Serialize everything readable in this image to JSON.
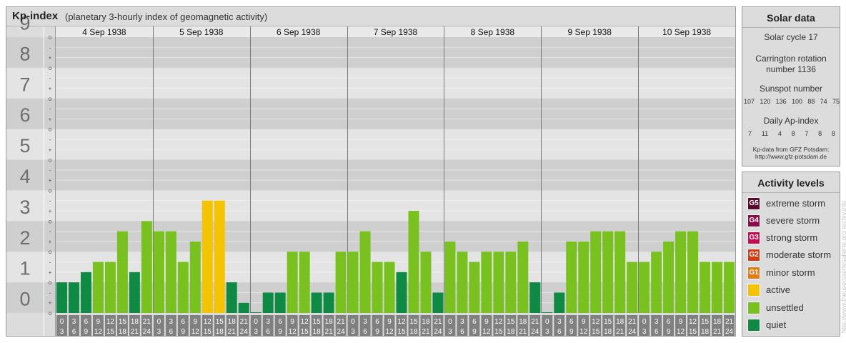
{
  "header": {
    "title": "Kp-index",
    "subtitle": "(planetary 3-hourly index of geomagnetic activity)"
  },
  "chart_data": {
    "type": "bar",
    "ylim": [
      0,
      9
    ],
    "y_tick_labels": [
      "0",
      "1",
      "2",
      "3",
      "4",
      "5",
      "6",
      "7",
      "8",
      "9"
    ],
    "sub_tick_labels": [
      "o",
      "+",
      "-",
      "o",
      "+",
      "-",
      "o",
      "+",
      "-",
      "o",
      "+",
      "-",
      "o",
      "+",
      "-",
      "o",
      "+",
      "-",
      "o",
      "+",
      "-",
      "o",
      "+",
      "-",
      "o",
      "+",
      "-",
      "o"
    ],
    "days": [
      "4 Sep 1938",
      "5 Sep 1938",
      "6 Sep 1938",
      "7 Sep 1938",
      "8 Sep 1938",
      "9 Sep 1938",
      "10 Sep 1938"
    ],
    "interval_start_hours": [
      "0",
      "3",
      "6",
      "9",
      "12",
      "15",
      "18",
      "21"
    ],
    "interval_end_hours": [
      "3",
      "6",
      "9",
      "12",
      "15",
      "18",
      "21",
      "24"
    ],
    "values": [
      [
        1.0,
        1.0,
        1.333,
        1.667,
        1.667,
        2.667,
        1.333,
        3.0
      ],
      [
        2.667,
        2.667,
        1.667,
        2.333,
        3.667,
        3.667,
        1.0,
        0.333
      ],
      [
        0.0,
        0.667,
        0.667,
        2.0,
        2.0,
        0.667,
        0.667,
        2.0
      ],
      [
        2.0,
        2.667,
        1.667,
        1.667,
        1.333,
        3.333,
        2.0,
        0.667
      ],
      [
        2.333,
        2.0,
        1.667,
        2.0,
        2.0,
        2.0,
        2.333,
        1.0
      ],
      [
        0.0,
        0.667,
        2.333,
        2.333,
        2.667,
        2.667,
        2.667,
        1.667
      ],
      [
        1.667,
        2.0,
        2.333,
        2.667,
        2.667,
        1.667,
        1.667,
        1.667
      ]
    ],
    "colors": {
      "quiet": "#0f8a45",
      "unsettled": "#79c11f",
      "active": "#f5c400",
      "G1": "#e07c12",
      "G2": "#d63a14",
      "G3": "#c80a55",
      "G4": "#8c0a4a",
      "G5": "#5a0a2e",
      "band_dark": "#cfcfcf",
      "band_light": "#e4e4e4",
      "hour_box": "#808080"
    }
  },
  "solar": {
    "title": "Solar data",
    "cycle": "Solar cycle 17",
    "carrington_line1": "Carrington rotation",
    "carrington_line2": "number 1136",
    "sunspot_label": "Sunspot number",
    "sunspot_values": [
      "107",
      "120",
      "136",
      "100",
      "88",
      "74",
      "75"
    ],
    "ap_label": "Daily Ap-index",
    "ap_values": [
      "7",
      "11",
      "4",
      "8",
      "7",
      "8",
      "8"
    ],
    "credit_line1": "Kp-data from GFZ Potsdam:",
    "credit_line2": "http://www.gfz-potsdam.de"
  },
  "activity": {
    "title": "Activity levels",
    "levels": [
      {
        "badge": "G5",
        "label": "extreme storm",
        "color": "#5a0a2e"
      },
      {
        "badge": "G4",
        "label": "severe storm",
        "color": "#8c0a4a"
      },
      {
        "badge": "G3",
        "label": "strong storm",
        "color": "#c80a55"
      },
      {
        "badge": "G2",
        "label": "moderate storm",
        "color": "#d63a14"
      },
      {
        "badge": "G1",
        "label": "minor storm",
        "color": "#e07c12"
      },
      {
        "badge": "",
        "label": "active",
        "color": "#f5c400"
      },
      {
        "badge": "",
        "label": "unsettled",
        "color": "#79c11f"
      },
      {
        "badge": "",
        "label": "quiet",
        "color": "#0f8a45"
      }
    ]
  },
  "watermark": "http://www.theusersseriesallerte.org archiv.info"
}
